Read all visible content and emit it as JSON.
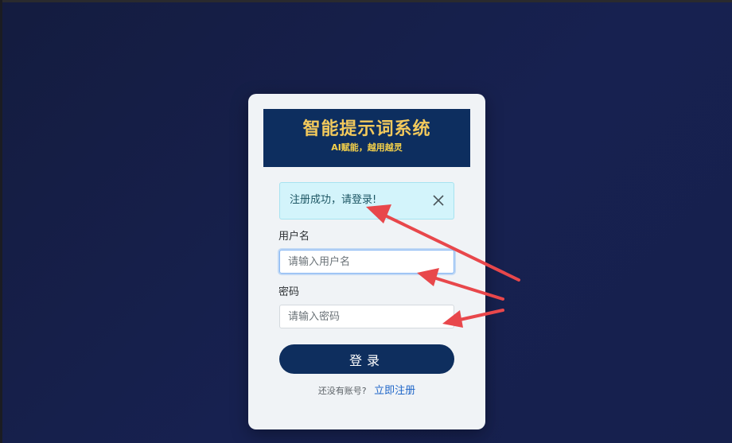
{
  "banner": {
    "title": "智能提示词系统",
    "subtitle": "AI赋能，越用越灵"
  },
  "alert": {
    "message": "注册成功，请登录!",
    "close_icon": "close-icon"
  },
  "form": {
    "username_label": "用户名",
    "username_placeholder": "请输入用户名",
    "username_value": "",
    "password_label": "密码",
    "password_placeholder": "请输入密码",
    "password_value": "",
    "login_label": "登录"
  },
  "register": {
    "prompt": "还没有账号?",
    "link_label": "立即注册"
  },
  "colors": {
    "background": "#16204d",
    "banner": "#0d2e5f",
    "banner_title": "#f2c95c",
    "alert_bg": "#d3f4fb",
    "button": "#0e2e5e",
    "link": "#1f66c8",
    "annotation_arrow": "#e8474b"
  }
}
